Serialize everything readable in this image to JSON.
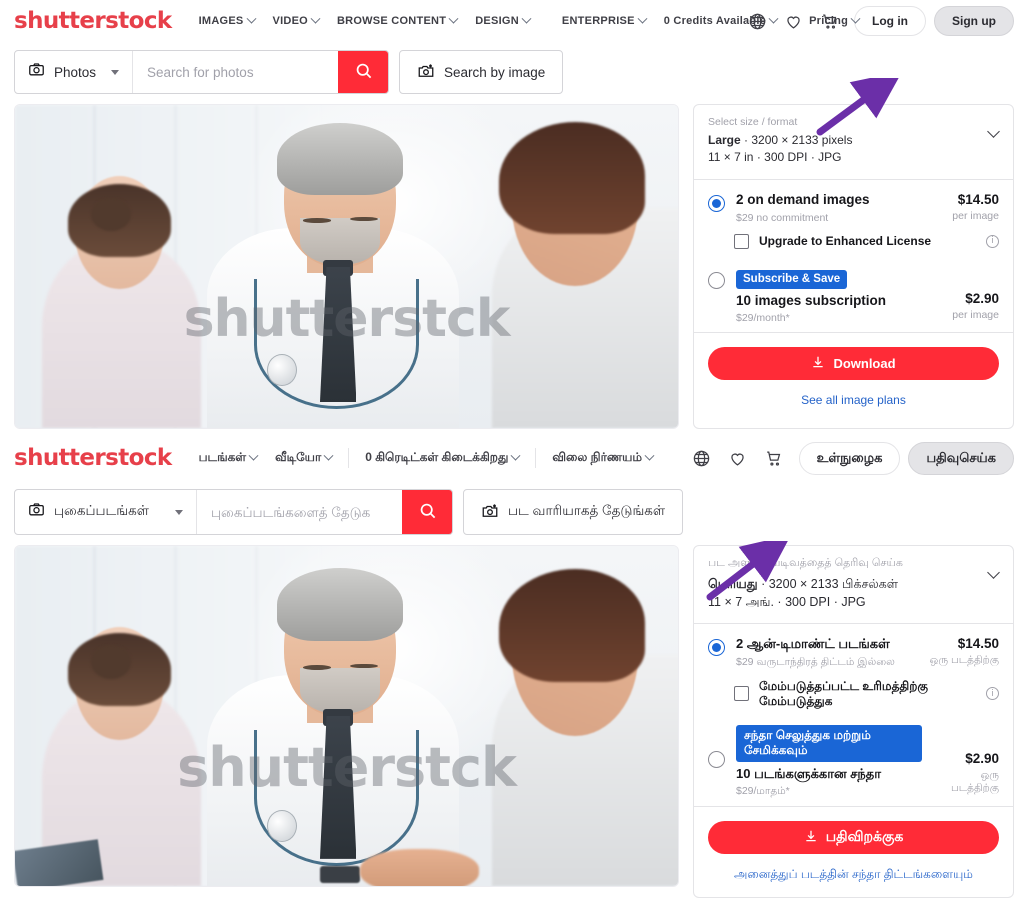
{
  "brand": {
    "logo": "shutterstck",
    "accent": "#e7404a",
    "cta_red": "#ff2b37",
    "blue": "#1a66d6",
    "link_blue": "#2563c9",
    "arrow_purple": "#6b2fa8"
  },
  "section_en": {
    "nav": {
      "items": [
        {
          "label": "IMAGES",
          "caret": true
        },
        {
          "label": "VIDEO",
          "caret": true
        },
        {
          "label": "BROWSE CONTENT",
          "caret": true
        },
        {
          "label": "DESIGN",
          "caret": true
        },
        {
          "label": "ENTERPRISE",
          "caret": true
        },
        {
          "label": "0 Credits Available",
          "caret": true
        },
        {
          "label": "Pricing",
          "caret": true
        }
      ],
      "icons": [
        "globe-icon",
        "heart-icon",
        "cart-icon"
      ],
      "login": "Log in",
      "signup": "Sign up"
    },
    "search": {
      "category": "Photos",
      "category_icon": "camera-icon",
      "placeholder": "Search for photos",
      "value": "",
      "submit_icon": "search-icon",
      "image_search": "Search by image",
      "image_search_icon": "camera-plus-icon"
    },
    "photo": {
      "watermark": "shutterstck",
      "alt": "Doctor shaking hands with a patient while a nurse smiles"
    },
    "panel": {
      "size_label": "Select size / format",
      "size_name": "Large",
      "size_dims": "3200 × 2133 pixels",
      "size_detail": "11 × 7 in · 300 DPI · JPG",
      "chevron_icon": "chevron-down-icon",
      "options": [
        {
          "selected": true,
          "badge": "",
          "title": "2 on demand images",
          "sub": "$29 no commitment",
          "price": "$14.50",
          "per": "per image",
          "upgrade": "Upgrade to Enhanced License",
          "upgrade_info_icon": "info-icon"
        },
        {
          "selected": false,
          "badge": "Subscribe & Save",
          "title": "10 images subscription",
          "sub": "$29/month*",
          "price": "$2.90",
          "per": "per image"
        }
      ],
      "download": "Download",
      "download_icon": "download-icon",
      "plans_link": "See all image plans"
    }
  },
  "section_ta": {
    "nav": {
      "items": [
        {
          "label": "படங்கள்",
          "caret": true
        },
        {
          "label": "வீடியோ",
          "caret": true
        },
        {
          "label": "0 கிரெடிட்கள் கிடைக்கிறது",
          "caret": true
        },
        {
          "label": "விலை நிர்ணயம்",
          "caret": true
        }
      ],
      "icons": [
        "globe-icon",
        "heart-icon",
        "cart-icon"
      ],
      "login": "உள்நுழைக",
      "signup": "பதிவுசெய்க"
    },
    "search": {
      "category": "புகைப்படங்கள்",
      "category_icon": "camera-icon",
      "placeholder": "புகைப்படங்களைத் தேடுக",
      "value": "",
      "submit_icon": "search-icon",
      "image_search": "பட வாரியாகத் தேடுங்கள்",
      "image_search_icon": "camera-plus-icon"
    },
    "photo": {
      "watermark": "shutterstck",
      "alt": "Doctor shaking hands with a patient while a nurse smiles"
    },
    "panel": {
      "size_label": "பட அளவு / வடிவத்தைத் தெரிவு செய்க",
      "size_name": "பெரியது",
      "size_dims": "3200 × 2133 பிக்சல்கள்",
      "size_detail": "11 × 7 அங். · 300 DPI · JPG",
      "chevron_icon": "chevron-down-icon",
      "options": [
        {
          "selected": true,
          "badge": "",
          "title": "2 ஆன்-டிமாண்ட் படங்கள்",
          "sub": "$29 வருடாந்திரத் திட்டம் இல்லை",
          "price": "$14.50",
          "per": "ஒரு படத்திற்கு",
          "upgrade": "மேம்படுத்தப்பட்ட உரிமத்திற்கு மேம்படுத்துக",
          "upgrade_info_icon": "info-icon"
        },
        {
          "selected": false,
          "badge": "சந்தா செலுத்துக மற்றும் சேமிக்கவும்",
          "title": "10 படங்களுக்கான சந்தா",
          "sub": "$29/மாதம்*",
          "price": "$2.90",
          "per": "ஒரு படத்திற்கு"
        }
      ],
      "download": "பதிவிறக்குக",
      "download_icon": "download-icon",
      "plans_link": "அனைத்துப் படத்தின் சந்தா திட்டங்களையும்"
    }
  },
  "annotations": [
    {
      "name": "arrow-to-search-by-image-en",
      "points_to": "Search by image",
      "color": "#6b2fa8"
    },
    {
      "name": "arrow-to-search-by-image-ta",
      "points_to": "பட வாரியாகத் தேடுங்கள்",
      "color": "#6b2fa8"
    }
  ]
}
